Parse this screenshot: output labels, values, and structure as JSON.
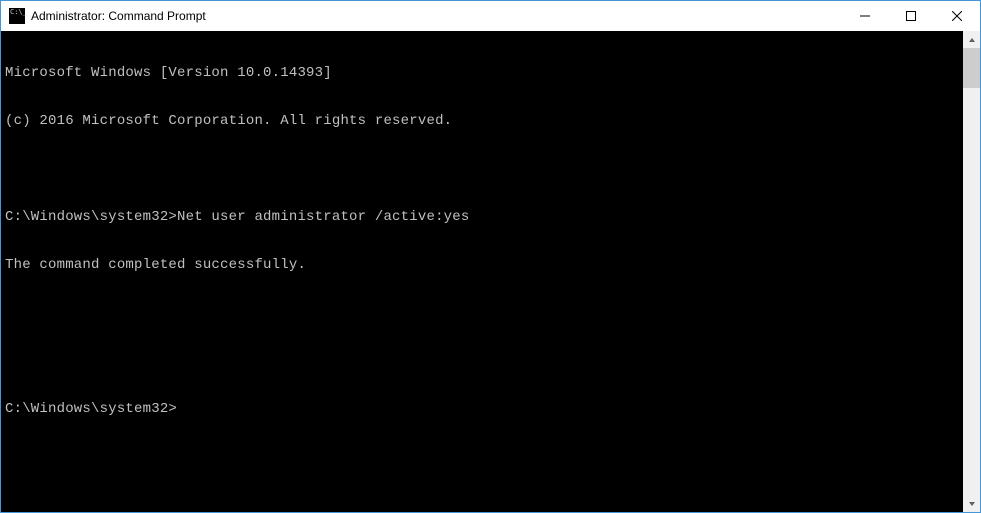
{
  "window": {
    "title": "Administrator: Command Prompt"
  },
  "terminal": {
    "lines": [
      "Microsoft Windows [Version 10.0.14393]",
      "(c) 2016 Microsoft Corporation. All rights reserved.",
      "",
      "C:\\Windows\\system32>Net user administrator /active:yes",
      "The command completed successfully.",
      "",
      "",
      "C:\\Windows\\system32>"
    ]
  }
}
